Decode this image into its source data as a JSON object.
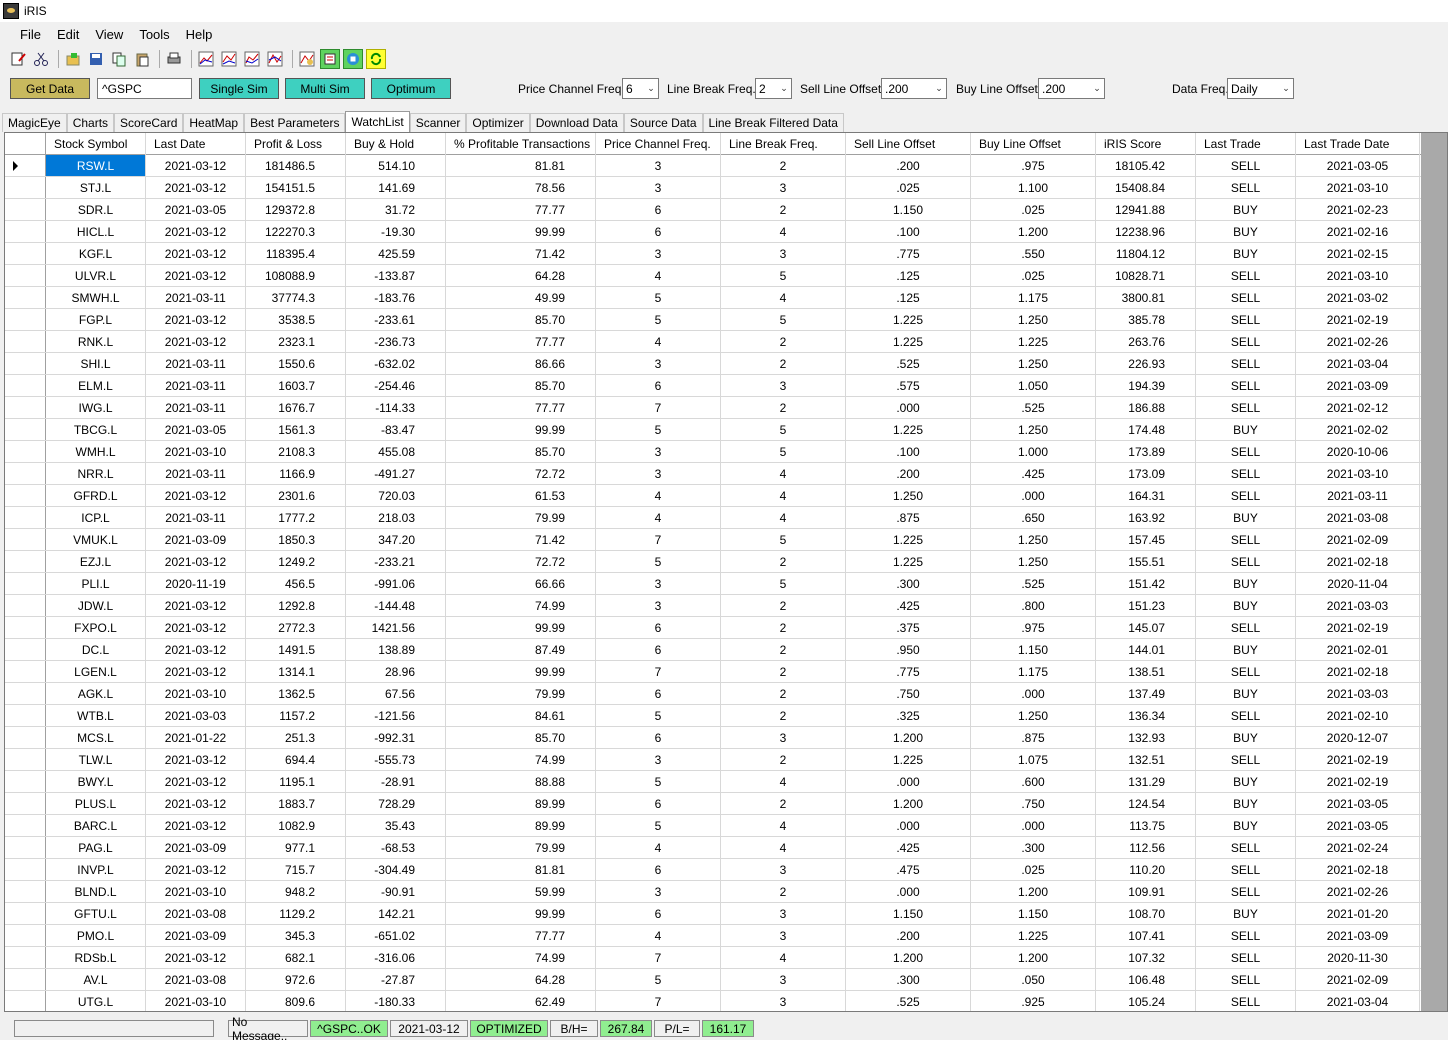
{
  "window": {
    "title": "iRIS"
  },
  "menu": [
    "File",
    "Edit",
    "View",
    "Tools",
    "Help"
  ],
  "toolbar": {
    "icons": [
      "new-icon",
      "cut-icon",
      "open-icon",
      "save-icon",
      "copy-icon",
      "paste-icon",
      "print-icon",
      "chart-icon",
      "chart-icon",
      "chart-icon",
      "chart-icon",
      "chart-icon",
      "report-icon",
      "stop-icon",
      "refresh-icon"
    ]
  },
  "controls": {
    "get_data": "Get Data",
    "symbol_value": "^GSPC",
    "single_sim": "Single Sim",
    "multi_sim": "Multi Sim",
    "optimum": "Optimum",
    "price_channel_label": "Price Channel Freq.",
    "price_channel_value": "6",
    "line_break_label": "Line Break Freq.",
    "line_break_value": "2",
    "sell_offset_label": "Sell Line Offset",
    "sell_offset_value": ".200",
    "buy_offset_label": "Buy Line Offset",
    "buy_offset_value": ".200",
    "data_freq_label": "Data Freq.",
    "data_freq_value": "Daily"
  },
  "tabs": [
    "MagicEye",
    "Charts",
    "ScoreCard",
    "HeatMap",
    "Best Parameters",
    "WatchList",
    "Scanner",
    "Optimizer",
    "Download Data",
    "Source Data",
    "Line Break Filtered Data"
  ],
  "active_tab": "WatchList",
  "table": {
    "columns": [
      "Stock Symbol",
      "Last Date",
      "Profit & Loss",
      "Buy & Hold",
      "% Profitable Transactions",
      "Price Channel Freq.",
      "Line Break Freq.",
      "Sell Line Offset",
      "Buy Line Offset",
      "iRIS Score",
      "Last Trade",
      "Last Trade Date"
    ],
    "rows": [
      [
        "RSW.L",
        "2021-03-12",
        "181486.5",
        "514.10",
        "81.81",
        "3",
        "2",
        ".200",
        ".975",
        "18105.42",
        "SELL",
        "2021-03-05"
      ],
      [
        "STJ.L",
        "2021-03-12",
        "154151.5",
        "141.69",
        "78.56",
        "3",
        "3",
        ".025",
        "1.100",
        "15408.84",
        "SELL",
        "2021-03-10"
      ],
      [
        "SDR.L",
        "2021-03-05",
        "129372.8",
        "31.72",
        "77.77",
        "6",
        "2",
        "1.150",
        ".025",
        "12941.88",
        "BUY",
        "2021-02-23"
      ],
      [
        "HICL.L",
        "2021-03-12",
        "122270.3",
        "-19.30",
        "99.99",
        "6",
        "4",
        ".100",
        "1.200",
        "12238.96",
        "BUY",
        "2021-02-16"
      ],
      [
        "KGF.L",
        "2021-03-12",
        "118395.4",
        "425.59",
        "71.42",
        "3",
        "3",
        ".775",
        ".550",
        "11804.12",
        "BUY",
        "2021-02-15"
      ],
      [
        "ULVR.L",
        "2021-03-12",
        "108088.9",
        "-133.87",
        "64.28",
        "4",
        "5",
        ".125",
        ".025",
        "10828.71",
        "SELL",
        "2021-03-10"
      ],
      [
        "SMWH.L",
        "2021-03-11",
        "37774.3",
        "-183.76",
        "49.99",
        "5",
        "4",
        ".125",
        "1.175",
        "3800.81",
        "SELL",
        "2021-03-02"
      ],
      [
        "FGP.L",
        "2021-03-12",
        "3538.5",
        "-233.61",
        "85.70",
        "5",
        "5",
        "1.225",
        "1.250",
        "385.78",
        "SELL",
        "2021-02-19"
      ],
      [
        "RNK.L",
        "2021-03-12",
        "2323.1",
        "-236.73",
        "77.77",
        "4",
        "2",
        "1.225",
        "1.225",
        "263.76",
        "SELL",
        "2021-02-26"
      ],
      [
        "SHI.L",
        "2021-03-11",
        "1550.6",
        "-632.02",
        "86.66",
        "3",
        "2",
        ".525",
        "1.250",
        "226.93",
        "SELL",
        "2021-03-04"
      ],
      [
        "ELM.L",
        "2021-03-11",
        "1603.7",
        "-254.46",
        "85.70",
        "6",
        "3",
        ".575",
        "1.050",
        "194.39",
        "SELL",
        "2021-03-09"
      ],
      [
        "IWG.L",
        "2021-03-11",
        "1676.7",
        "-114.33",
        "77.77",
        "7",
        "2",
        ".000",
        ".525",
        "186.88",
        "SELL",
        "2021-02-12"
      ],
      [
        "TBCG.L",
        "2021-03-05",
        "1561.3",
        "-83.47",
        "99.99",
        "5",
        "5",
        "1.225",
        "1.250",
        "174.48",
        "BUY",
        "2021-02-02"
      ],
      [
        "WMH.L",
        "2021-03-10",
        "2108.3",
        "455.08",
        "85.70",
        "3",
        "5",
        ".100",
        "1.000",
        "173.89",
        "SELL",
        "2020-10-06"
      ],
      [
        "NRR.L",
        "2021-03-11",
        "1166.9",
        "-491.27",
        "72.72",
        "3",
        "4",
        ".200",
        ".425",
        "173.09",
        "SELL",
        "2021-03-10"
      ],
      [
        "GFRD.L",
        "2021-03-12",
        "2301.6",
        "720.03",
        "61.53",
        "4",
        "4",
        "1.250",
        ".000",
        "164.31",
        "SELL",
        "2021-03-11"
      ],
      [
        "ICP.L",
        "2021-03-11",
        "1777.2",
        "218.03",
        "79.99",
        "4",
        "4",
        ".875",
        ".650",
        "163.92",
        "BUY",
        "2021-03-08"
      ],
      [
        "VMUK.L",
        "2021-03-09",
        "1850.3",
        "347.20",
        "71.42",
        "7",
        "5",
        "1.225",
        "1.250",
        "157.45",
        "SELL",
        "2021-02-09"
      ],
      [
        "EZJ.L",
        "2021-03-12",
        "1249.2",
        "-233.21",
        "72.72",
        "5",
        "2",
        "1.225",
        "1.250",
        "155.51",
        "SELL",
        "2021-02-18"
      ],
      [
        "PLI.L",
        "2020-11-19",
        "456.5",
        "-991.06",
        "66.66",
        "3",
        "5",
        ".300",
        ".525",
        "151.42",
        "BUY",
        "2020-11-04"
      ],
      [
        "JDW.L",
        "2021-03-12",
        "1292.8",
        "-144.48",
        "74.99",
        "3",
        "2",
        ".425",
        ".800",
        "151.23",
        "BUY",
        "2021-03-03"
      ],
      [
        "FXPO.L",
        "2021-03-12",
        "2772.3",
        "1421.56",
        "99.99",
        "6",
        "2",
        ".375",
        ".975",
        "145.07",
        "SELL",
        "2021-02-19"
      ],
      [
        "DC.L",
        "2021-03-12",
        "1491.5",
        "138.89",
        "87.49",
        "6",
        "2",
        ".950",
        "1.150",
        "144.01",
        "BUY",
        "2021-02-01"
      ],
      [
        "LGEN.L",
        "2021-03-12",
        "1314.1",
        "28.96",
        "99.99",
        "7",
        "2",
        ".775",
        "1.175",
        "138.51",
        "SELL",
        "2021-02-18"
      ],
      [
        "AGK.L",
        "2021-03-10",
        "1362.5",
        "67.56",
        "79.99",
        "6",
        "2",
        ".750",
        ".000",
        "137.49",
        "BUY",
        "2021-03-03"
      ],
      [
        "WTB.L",
        "2021-03-03",
        "1157.2",
        "-121.56",
        "84.61",
        "5",
        "2",
        ".325",
        "1.250",
        "136.34",
        "SELL",
        "2021-02-10"
      ],
      [
        "MCS.L",
        "2021-01-22",
        "251.3",
        "-992.31",
        "85.70",
        "6",
        "3",
        "1.200",
        ".875",
        "132.93",
        "BUY",
        "2020-12-07"
      ],
      [
        "TLW.L",
        "2021-03-12",
        "694.4",
        "-555.73",
        "74.99",
        "3",
        "2",
        "1.225",
        "1.075",
        "132.51",
        "SELL",
        "2021-02-19"
      ],
      [
        "BWY.L",
        "2021-03-12",
        "1195.1",
        "-28.91",
        "88.88",
        "5",
        "4",
        ".000",
        ".600",
        "131.29",
        "BUY",
        "2021-02-19"
      ],
      [
        "PLUS.L",
        "2021-03-12",
        "1883.7",
        "728.29",
        "89.99",
        "6",
        "2",
        "1.200",
        ".750",
        "124.54",
        "BUY",
        "2021-03-05"
      ],
      [
        "BARC.L",
        "2021-03-12",
        "1082.9",
        "35.43",
        "89.99",
        "5",
        "4",
        ".000",
        ".000",
        "113.75",
        "BUY",
        "2021-03-05"
      ],
      [
        "PAG.L",
        "2021-03-09",
        "977.1",
        "-68.53",
        "79.99",
        "4",
        "4",
        ".425",
        ".300",
        "112.56",
        "SELL",
        "2021-02-24"
      ],
      [
        "INVP.L",
        "2021-03-12",
        "715.7",
        "-304.49",
        "81.81",
        "6",
        "3",
        ".475",
        ".025",
        "110.20",
        "SELL",
        "2021-02-18"
      ],
      [
        "BLND.L",
        "2021-03-10",
        "948.2",
        "-90.91",
        "59.99",
        "3",
        "2",
        ".000",
        "1.200",
        "109.91",
        "SELL",
        "2021-02-26"
      ],
      [
        "GFTU.L",
        "2021-03-08",
        "1129.2",
        "142.21",
        "99.99",
        "6",
        "3",
        "1.150",
        "1.150",
        "108.70",
        "BUY",
        "2021-01-20"
      ],
      [
        "PMO.L",
        "2021-03-09",
        "345.3",
        "-651.02",
        "77.77",
        "4",
        "3",
        ".200",
        "1.225",
        "107.41",
        "SELL",
        "2021-03-09"
      ],
      [
        "RDSb.L",
        "2021-03-12",
        "682.1",
        "-316.06",
        "74.99",
        "7",
        "4",
        "1.200",
        "1.200",
        "107.32",
        "SELL",
        "2020-11-30"
      ],
      [
        "AV.L",
        "2021-03-08",
        "972.6",
        "-27.87",
        "64.28",
        "5",
        "3",
        ".300",
        ".050",
        "106.48",
        "SELL",
        "2021-02-09"
      ],
      [
        "UTG.L",
        "2021-03-10",
        "809.6",
        "-180.33",
        "62.49",
        "7",
        "3",
        ".525",
        ".925",
        "105.24",
        "SELL",
        "2021-03-04"
      ]
    ]
  },
  "status": {
    "message": "No Message..",
    "symbol_ok": "^GSPC..OK",
    "date": "2021-03-12",
    "state": "OPTIMIZED",
    "bh_label": "B/H=",
    "bh_value": "267.84",
    "pl_label": "P/L=",
    "pl_value": "161.17"
  },
  "colors": {
    "get_data": "#c8b95e",
    "sim_buttons": "#3ed0c0",
    "selection": "#0078d7",
    "status_green": "#90ee90"
  }
}
